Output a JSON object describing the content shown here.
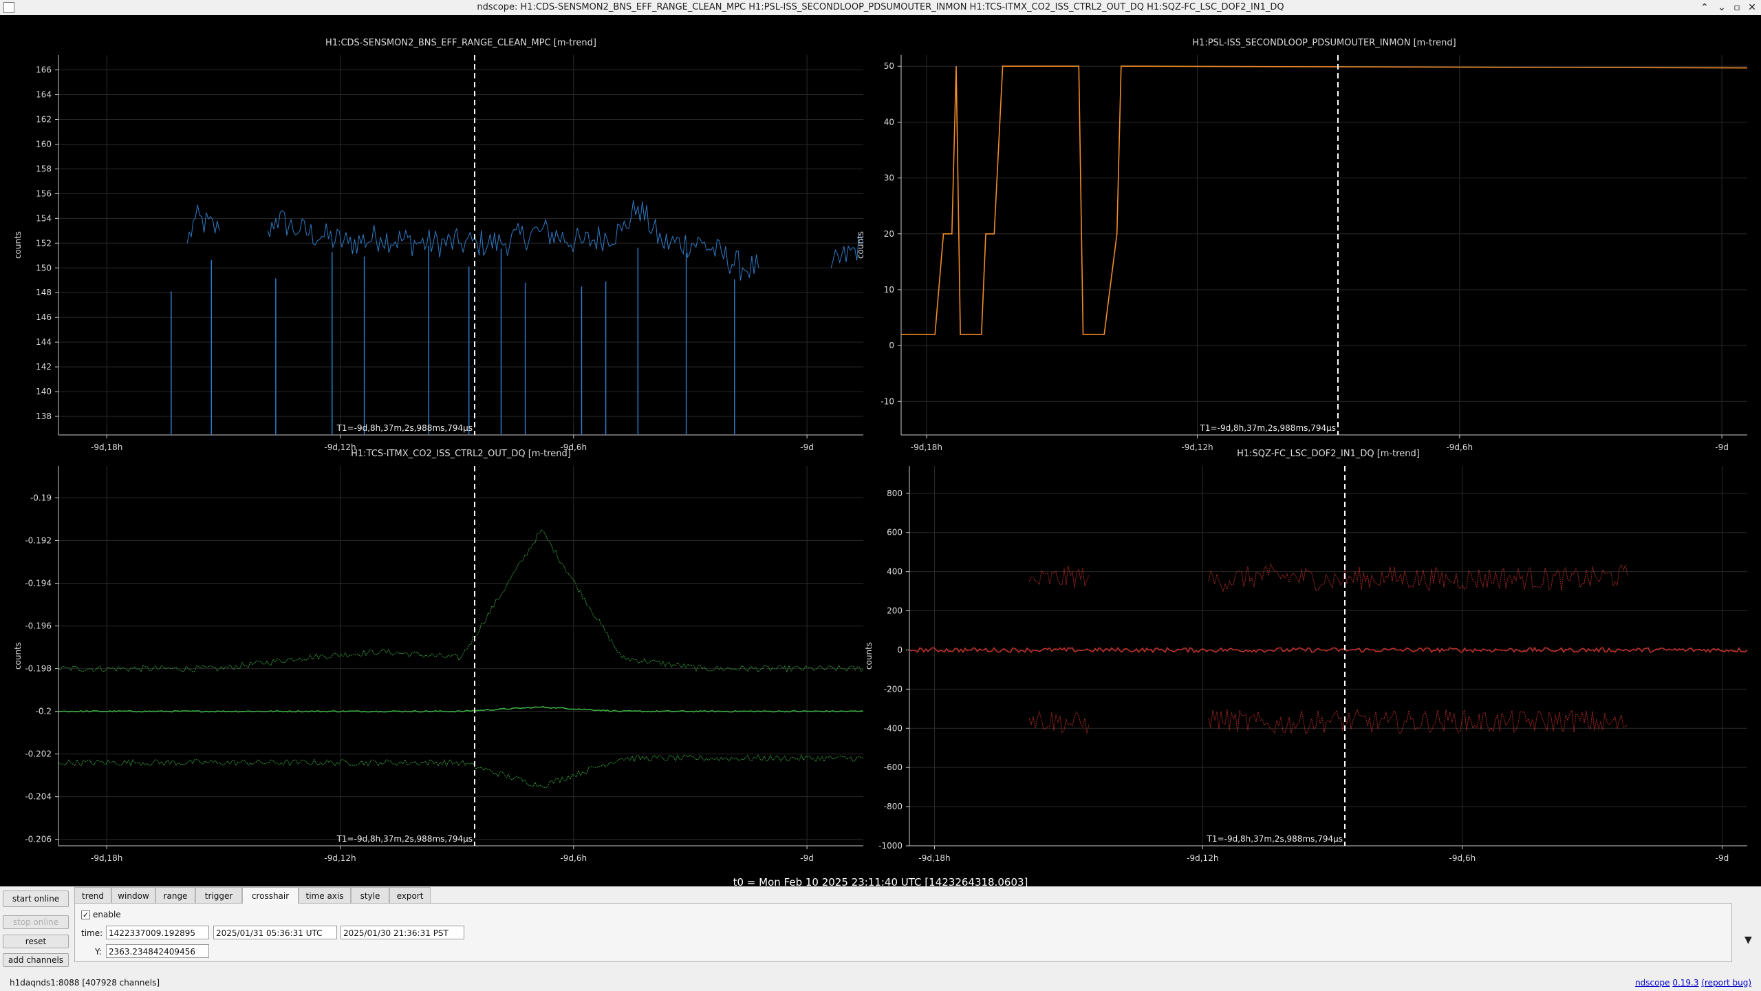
{
  "window": {
    "title": "ndscope: H1:CDS-SENSMON2_BNS_EFF_RANGE_CLEAN_MPC H1:PSL-ISS_SECONDLOOP_PDSUMOUTER_INMON H1:TCS-ITMX_CO2_ISS_CTRL2_OUT_DQ H1:SQZ-FC_LSC_DOF2_IN1_DQ",
    "min_glyph": "⌃",
    "restore_glyph": "▫",
    "close_glyph": "✕",
    "minimize_glyph": "⌄"
  },
  "crosshair_label": "T1=-9d,8h,37m,2s,988ms,794µs",
  "t0_label": "t0 = Mon Feb 10 2025 23:11:40 UTC [1423264318.0603]",
  "chart_data": [
    {
      "type": "line",
      "title": "H1:CDS-SENSMON2_BNS_EFF_RANGE_CLEAN_MPC [m-trend]",
      "ylabel": "counts",
      "ylim": [
        136.5,
        167.2
      ],
      "yticks": [
        138,
        140,
        142,
        144,
        146,
        148,
        150,
        152,
        154,
        156,
        158,
        160,
        162,
        164,
        166
      ],
      "x_tick_labels": [
        "-9d,18h",
        "-9d,12h",
        "-9d,6h",
        "-9d"
      ],
      "color": "#2e7bc6",
      "series": [
        {
          "x": [
            0,
            0.15,
            0.16,
            0.17,
            0.2,
            0.21,
            0.25,
            0.26,
            0.27,
            0.3,
            0.33,
            0.36,
            0.4,
            0.45,
            0.5,
            0.52,
            0.55,
            0.6,
            0.65,
            0.7,
            0.72,
            0.75,
            0.8,
            0.85,
            0.87,
            0.88,
            0.95,
            0.96,
            1.0
          ],
          "values": [
            null,
            null,
            152,
            154,
            153,
            null,
            null,
            153,
            154,
            153,
            152.5,
            152,
            152.5,
            152,
            152,
            152,
            152,
            153,
            152,
            153,
            155,
            152,
            152,
            150,
            150,
            null,
            null,
            150,
            152
          ]
        }
      ],
      "dropouts": [
        0.14,
        0.19,
        0.27,
        0.34,
        0.38,
        0.46,
        0.51,
        0.55,
        0.58,
        0.65,
        0.68,
        0.72,
        0.78,
        0.84
      ]
    },
    {
      "type": "line",
      "title": "H1:PSL-ISS_SECONDLOOP_PDSUMOUTER_INMON [m-trend]",
      "ylabel": "counts",
      "ylim": [
        -16,
        52
      ],
      "yticks": [
        -10,
        0,
        10,
        20,
        30,
        40,
        50
      ],
      "x_tick_labels": [
        "-9d,18h",
        "-9d,12h",
        "-9d,6h",
        "-9d"
      ],
      "color": "#f28c28",
      "series": [
        {
          "x": [
            0.0,
            0.03,
            0.04,
            0.05,
            0.06,
            0.065,
            0.07,
            0.095,
            0.1,
            0.11,
            0.12,
            0.125,
            0.135,
            0.14,
            0.15,
            0.21,
            0.215,
            0.24,
            0.255,
            0.26,
            0.27,
            1.0
          ],
          "values": [
            2,
            2,
            2,
            20,
            20,
            50,
            2,
            2,
            20,
            20,
            50,
            50,
            50,
            50,
            50,
            50,
            2,
            2,
            20,
            50,
            50,
            49.7
          ]
        }
      ]
    },
    {
      "type": "line",
      "title": "H1:TCS-ITMX_CO2_ISS_CTRL2_OUT_DQ [m-trend]",
      "ylabel": "counts",
      "ylim": [
        -0.2063,
        -0.1885
      ],
      "yticks": [
        -0.19,
        -0.192,
        -0.194,
        -0.196,
        -0.198,
        -0.2,
        -0.202,
        -0.204,
        -0.206
      ],
      "x_tick_labels": [
        "-9d,18h",
        "-9d,12h",
        "-9d,6h",
        "-9d"
      ],
      "color": "#3cb043",
      "series": [
        {
          "name": "max",
          "values": [
            -0.198,
            -0.198,
            -0.198,
            -0.1975,
            -0.1972,
            -0.1975,
            -0.1915,
            -0.1975,
            -0.198,
            -0.198,
            -0.198
          ]
        },
        {
          "name": "mean",
          "values": [
            -0.2,
            -0.2,
            -0.2,
            -0.2,
            -0.2,
            -0.2,
            -0.1998,
            -0.2,
            -0.2,
            -0.2,
            -0.2
          ]
        },
        {
          "name": "min",
          "values": [
            -0.2024,
            -0.2024,
            -0.2024,
            -0.2024,
            -0.2024,
            -0.2024,
            -0.2035,
            -0.2022,
            -0.2022,
            -0.2022,
            -0.2022
          ]
        }
      ]
    },
    {
      "type": "line",
      "title": "H1:SQZ-FC_LSC_DOF2_IN1_DQ [m-trend]",
      "ylabel": "counts",
      "ylim": [
        -1000,
        940
      ],
      "yticks": [
        -1000,
        -800,
        -600,
        -400,
        -200,
        0,
        200,
        400,
        600,
        800
      ],
      "x_tick_labels": [
        "-9d,18h",
        "-9d,12h",
        "-9d,6h",
        "-9d"
      ],
      "color": "#c0302a",
      "series": [
        {
          "name": "max",
          "values": [
            null,
            null,
            350,
            380,
            null,
            350,
            380,
            360,
            370,
            360,
            370,
            360,
            380,
            null,
            330
          ]
        },
        {
          "name": "mean",
          "values": [
            0,
            0,
            0,
            0,
            0,
            0,
            0,
            0,
            0,
            0,
            0,
            0,
            0,
            0,
            0
          ]
        },
        {
          "name": "min",
          "values": [
            null,
            null,
            -350,
            -380,
            null,
            -350,
            -380,
            -360,
            -370,
            -360,
            -370,
            -360,
            -380,
            null,
            -330
          ]
        }
      ]
    }
  ],
  "tabs": [
    "trend",
    "window",
    "range",
    "trigger",
    "crosshair",
    "time axis",
    "style",
    "export"
  ],
  "active_tab": "crosshair",
  "buttons": {
    "start_online": "start online",
    "stop_online": "stop online",
    "reset": "reset",
    "add_channels": "add channels"
  },
  "crosshair": {
    "enable_label": "enable",
    "check_glyph": "✓",
    "time_label": "time:",
    "gps": "1422337009.192895",
    "utc": "2025/01/31 05:36:31 UTC",
    "pst": "2025/01/30 21:36:31 PST",
    "y_label": "Y:",
    "y_value": "2363.234842409456"
  },
  "dropdown_glyph": "▼",
  "status": {
    "server": "h1daqnds1:8088  [407928 channels]",
    "app_name": "ndscope",
    "version": "0.19.3",
    "report": "(report bug)"
  }
}
